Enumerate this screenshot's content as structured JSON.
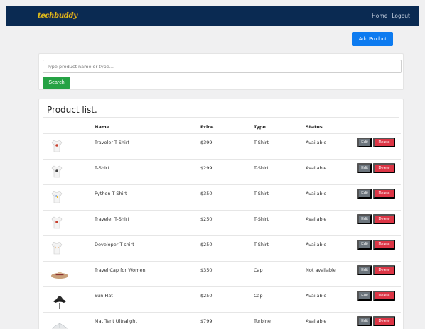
{
  "navbar": {
    "logo": "techbuddy",
    "links": [
      "Home",
      "Logout"
    ]
  },
  "toolbar": {
    "add_product_label": "Add Product"
  },
  "search": {
    "placeholder": "Type product name or type...",
    "button_label": "Search"
  },
  "product_list": {
    "title": "Product list.",
    "columns": [
      "Name",
      "Price",
      "Type",
      "Status"
    ],
    "edit_label": "Edit",
    "delete_label": "Delete",
    "rows": [
      {
        "name": "Traveler T-Shirt",
        "price": "$399",
        "type": "T-Shirt",
        "status": "Available",
        "thumb": "tshirt-red-icon"
      },
      {
        "name": "T-Shirt",
        "price": "$299",
        "type": "T-Shirt",
        "status": "Available",
        "thumb": "tshirt-gray-icon"
      },
      {
        "name": "Python T-Shirt",
        "price": "$350",
        "type": "T-Shirt",
        "status": "Available",
        "thumb": "tshirt-python-icon"
      },
      {
        "name": "Traveler T-Shirt",
        "price": "$250",
        "type": "T-Shirt",
        "status": "Available",
        "thumb": "tshirt-red-icon"
      },
      {
        "name": "Developer T-shirt",
        "price": "$250",
        "type": "T-Shirt",
        "status": "Available",
        "thumb": "tshirt-dev-icon"
      },
      {
        "name": "Travel Cap for Women",
        "price": "$350",
        "type": "Cap",
        "status": "Not available",
        "thumb": "womens-hat-icon"
      },
      {
        "name": "Sun Hat",
        "price": "$250",
        "type": "Cap",
        "status": "Available",
        "thumb": "sun-hat-icon"
      },
      {
        "name": "Mat Tent Ultralight",
        "price": "$799",
        "type": "Turbine",
        "status": "Available",
        "thumb": "tent-icon"
      }
    ]
  },
  "colors": {
    "navbar": "#0a2a52",
    "primary": "#0d7bf0",
    "success": "#25a244",
    "secondary": "#6c757d",
    "danger": "#dc3545"
  }
}
